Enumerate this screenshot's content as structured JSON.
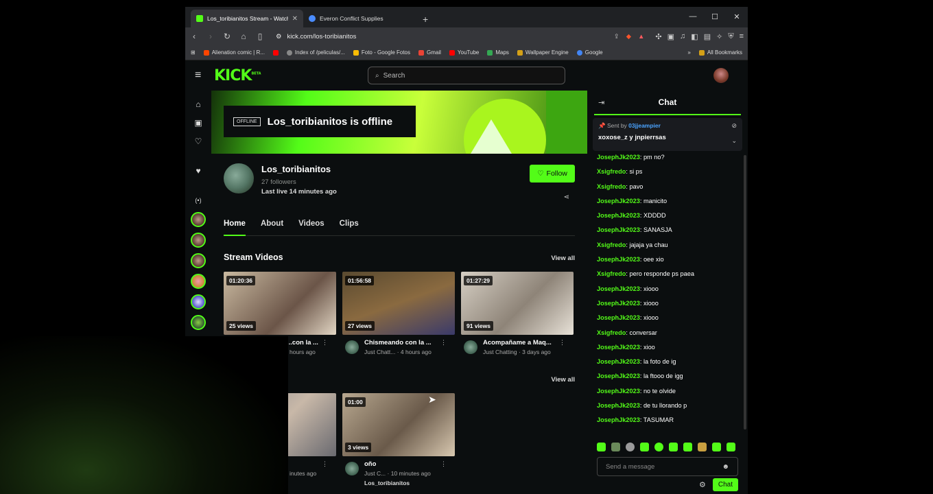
{
  "browser": {
    "tabs": [
      {
        "title": "Los_toribianitos Stream - Watch",
        "fav_color": "#53fc18"
      },
      {
        "title": "Everon Conflict Supplies",
        "fav_color": "#4a8cff"
      }
    ],
    "url": "kick.com/los-toribianitos",
    "bookmarks": [
      {
        "label": "Alienation comic | R...",
        "color": "#ff4500"
      },
      {
        "label": "",
        "color": "#ff0000"
      },
      {
        "label": "Index of /peliculas/...",
        "color": "#888888"
      },
      {
        "label": "Foto - Google Fotos",
        "color": "#fbbc05"
      },
      {
        "label": "Gmail",
        "color": "#ea4335"
      },
      {
        "label": "YouTube",
        "color": "#ff0000"
      },
      {
        "label": "Maps",
        "color": "#34a853"
      },
      {
        "label": "Wallpaper Engine",
        "color": "#d4a017"
      },
      {
        "label": "Google",
        "color": "#4285f4"
      }
    ],
    "all_bookmarks": "All Bookmarks"
  },
  "header": {
    "logo": "KICK",
    "logo_sup": "BETA",
    "search_placeholder": "Search"
  },
  "banner": {
    "badge": "OFFLINE",
    "text": "Los_toribianitos is offline"
  },
  "channel": {
    "name": "Los_toribianitos",
    "followers": "27 followers",
    "last_live": "Last live 14 minutes ago",
    "follow_label": "Follow"
  },
  "tabs": [
    "Home",
    "About",
    "Videos",
    "Clips"
  ],
  "stream_videos": {
    "heading": "Stream Videos",
    "view_all": "View all",
    "items": [
      {
        "duration": "01:20:36",
        "views": "25 views",
        "title": "...con la ...",
        "sub": "hours ago"
      },
      {
        "duration": "01:56:58",
        "views": "27 views",
        "title": "Chismeando con la ...",
        "sub": "Just Chatt... · 4 hours ago"
      },
      {
        "duration": "01:27:29",
        "views": "91 views",
        "title": "Acompañame a Maq...",
        "sub": "Just Chatting · 3 days ago"
      }
    ]
  },
  "clips": {
    "view_all": "View all",
    "items": [
      {
        "duration": "",
        "views": "",
        "title": "",
        "sub": "inutes ago"
      },
      {
        "duration": "01:00",
        "views": "3 views",
        "title": "oño",
        "sub": "Just C... · 10 minutes ago",
        "channel": "Los_toribianitos"
      }
    ]
  },
  "chat": {
    "title": "Chat",
    "pinned_sent_by": "Sent by",
    "pinned_user": "03jjeampier",
    "pinned_text": "xoxose_z y jnpierrsas",
    "messages": [
      {
        "user": "JosephJk2023",
        "text": "pm no?"
      },
      {
        "user": "Xsigfredo",
        "text": "si ps"
      },
      {
        "user": "Xsigfredo",
        "text": "pavo"
      },
      {
        "user": "JosephJk2023",
        "text": "manicito"
      },
      {
        "user": "JosephJk2023",
        "text": "XDDDD"
      },
      {
        "user": "JosephJk2023",
        "text": "SANASJA"
      },
      {
        "user": "Xsigfredo",
        "text": "jajaja ya chau"
      },
      {
        "user": "JosephJk2023",
        "text": "oee xio"
      },
      {
        "user": "Xsigfredo",
        "text": "pero responde ps paea"
      },
      {
        "user": "JosephJk2023",
        "text": "xiooo"
      },
      {
        "user": "JosephJk2023",
        "text": "xiooo"
      },
      {
        "user": "JosephJk2023",
        "text": "xiooo"
      },
      {
        "user": "Xsigfredo",
        "text": "conversar"
      },
      {
        "user": "JosephJk2023",
        "text": "xioo"
      },
      {
        "user": "JosephJk2023",
        "text": "la foto de ig"
      },
      {
        "user": "JosephJk2023",
        "text": "la ftooo de igg"
      },
      {
        "user": "JosephJk2023",
        "text": "no te olvide"
      },
      {
        "user": "JosephJk2023",
        "text": "de tu llorando p"
      },
      {
        "user": "JosephJk2023",
        "text": "TASUMAR"
      }
    ],
    "input_placeholder": "Send a message",
    "send_label": "Chat"
  },
  "colors": {
    "accent": "#53fc18",
    "bg": "#0b0e0f"
  }
}
